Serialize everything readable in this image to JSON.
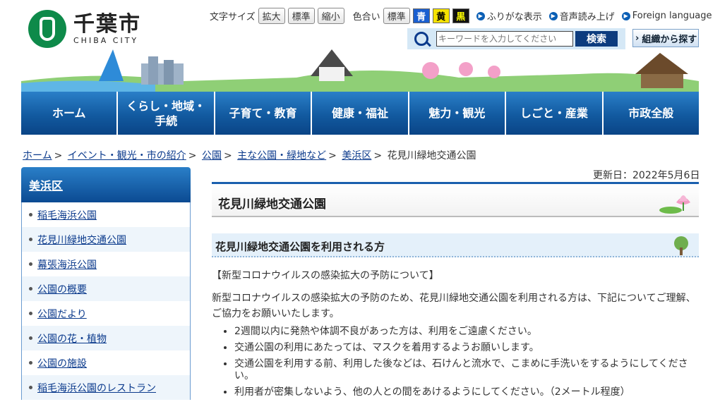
{
  "header": {
    "logo_jp": "千葉市",
    "logo_en": "CHIBA CITY",
    "font_size_label": "文字サイズ",
    "font_size_buttons": [
      "拡大",
      "標準",
      "縮小"
    ],
    "color_label": "色合い",
    "color_buttons": [
      "標準",
      "青",
      "黄",
      "黒"
    ],
    "links": [
      "ふりがな表示",
      "音声読み上げ",
      "Foreign language"
    ],
    "search_placeholder": "キーワードを入力してください",
    "search_button": "検索",
    "org_search": "組織から探す"
  },
  "colors": {
    "nav_blue": "#125aa0",
    "blue_button": "#1a5fd0",
    "yellow_button": "#f5e200",
    "black_button": "#111111"
  },
  "gnav": [
    "ホーム",
    "くらし・地域・\n手続",
    "子育て・教育",
    "健康・福祉",
    "魅力・観光",
    "しごと・産業",
    "市政全般"
  ],
  "breadcrumb": [
    "ホーム",
    "イベント・観光・市の紹介",
    "公園",
    "主な公園・緑地など",
    "美浜区",
    "花見川緑地交通公園"
  ],
  "sidebar": {
    "title": "美浜区",
    "items": [
      "稲毛海浜公園",
      "花見川緑地交通公園",
      "幕張海浜公園",
      "公園の概要",
      "公園だより",
      "公園の花・植物",
      "公園の施設",
      "稲毛海浜公園のレストラン"
    ]
  },
  "main": {
    "updated": "更新日：2022年5月6日",
    "title": "花見川緑地交通公園",
    "h2": "花見川緑地交通公園を利用される方",
    "notice": "【新型コロナウイルスの感染拡大の予防について】",
    "intro": "新型コロナウイルスの感染拡大の予防のため、花見川緑地交通公園を利用される方は、下記についてご理解、ご協力をお願いいたします。",
    "rules": [
      "2週間以内に発熱や体調不良があった方は、利用をご遠慮ください。",
      "交通公園の利用にあたっては、マスクを着用するようお願いします。",
      "交通公園を利用する前、利用した後などは、石けんと流水で、こまめに手洗いをするようにしてください。",
      "利用者が密集しないよう、他の人との間をあけるようにしてください。（2メートル程度）"
    ]
  }
}
